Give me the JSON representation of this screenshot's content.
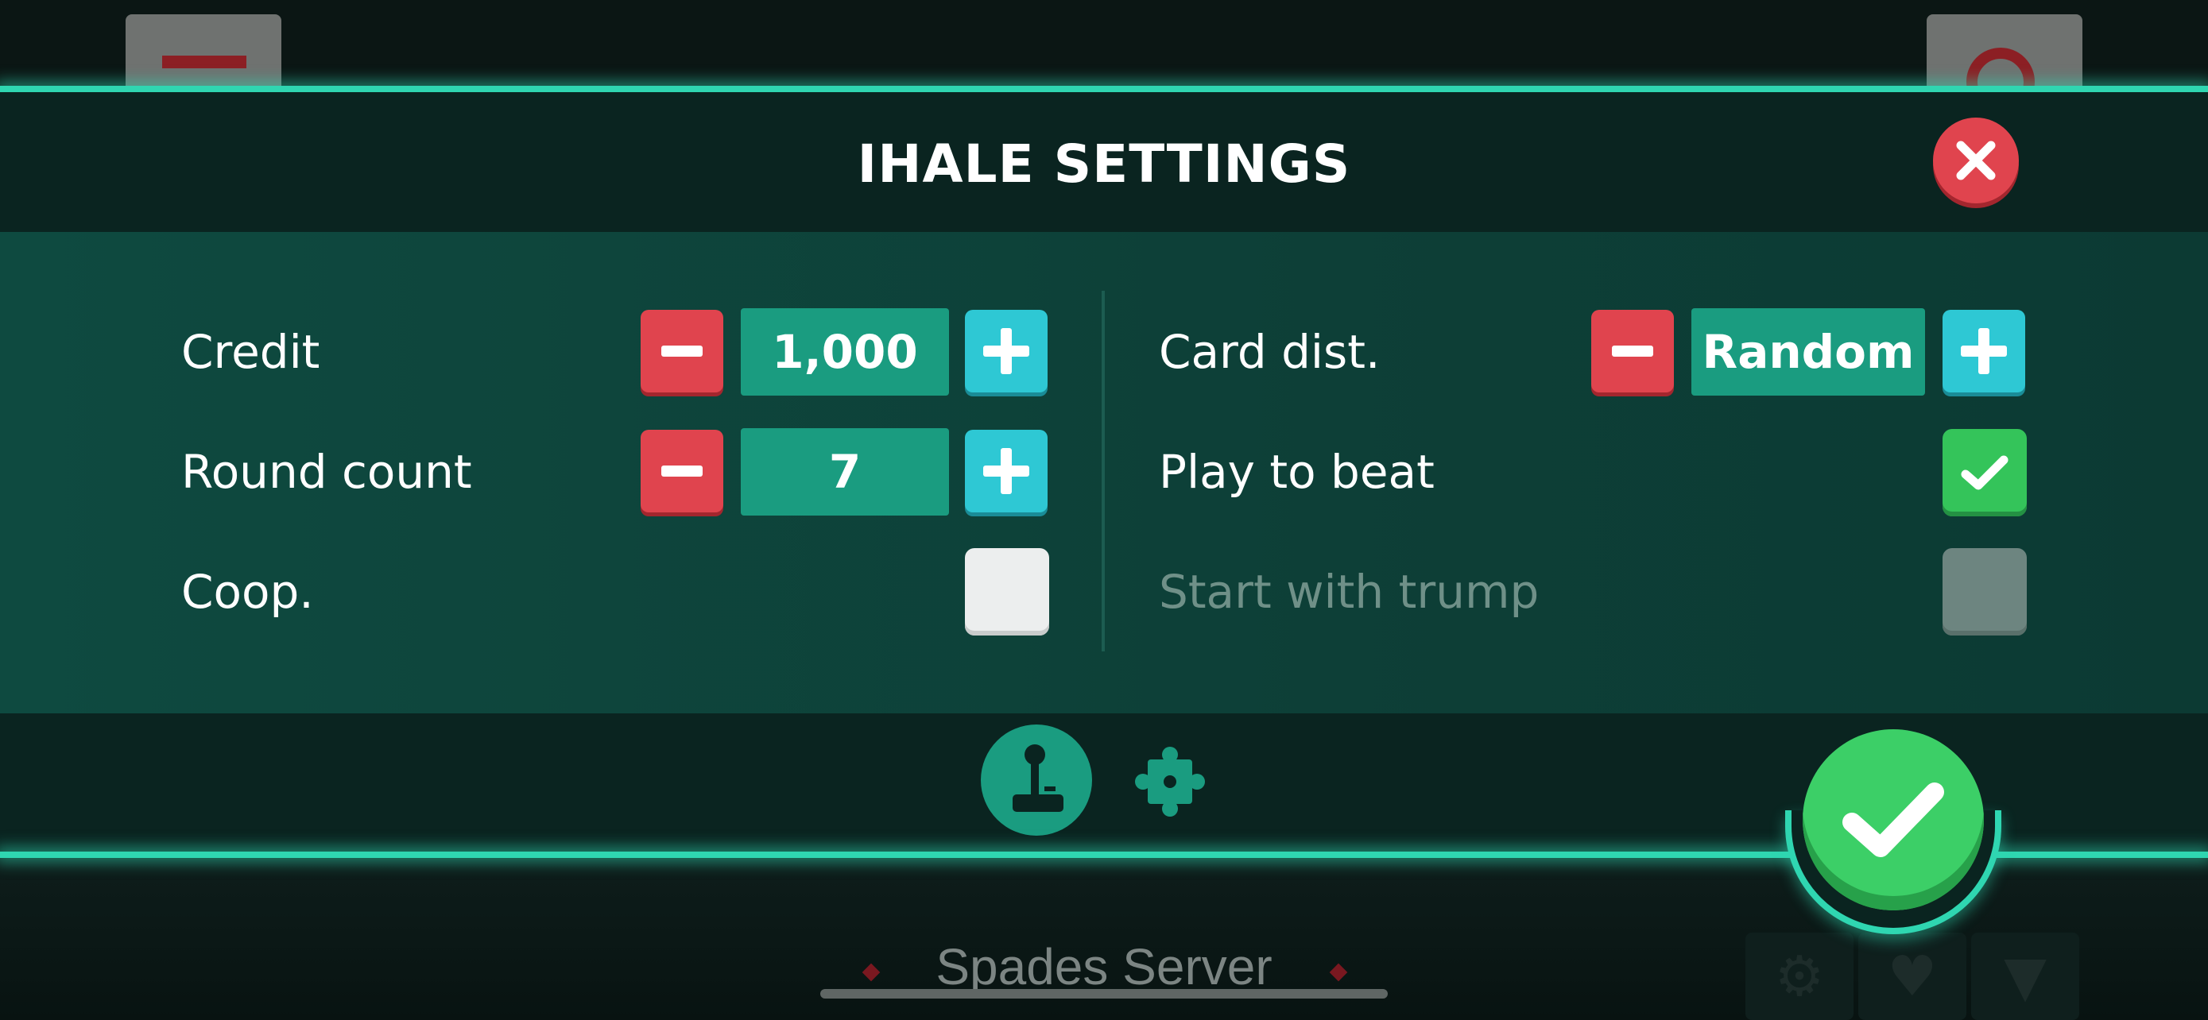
{
  "modal": {
    "title": "IHALE SETTINGS"
  },
  "settings_left": [
    {
      "label": "Credit",
      "value": "1,000",
      "control": "stepper"
    },
    {
      "label": "Round count",
      "value": "7",
      "control": "stepper"
    },
    {
      "label": "Coop.",
      "checked": false,
      "control": "checkbox"
    }
  ],
  "settings_right": [
    {
      "label": "Card dist.",
      "value": "Random",
      "control": "stepper"
    },
    {
      "label": "Play to beat",
      "checked": true,
      "control": "checkbox"
    },
    {
      "label": "Start with trump",
      "checked": false,
      "enabled": false,
      "control": "checkbox"
    }
  ],
  "footer": {
    "tabs": [
      {
        "icon": "joystick-icon",
        "active": true
      },
      {
        "icon": "puzzle-icon",
        "active": false
      }
    ],
    "confirm_icon": "checkmark-icon"
  },
  "background": {
    "server_label": "Spades Server",
    "bottom_icons": [
      "gear-icon",
      "heart-icon",
      "filter-icon"
    ]
  },
  "colors": {
    "accent_glow": "#2fd6b1",
    "minus_red": "#e0444e",
    "plus_cyan": "#2ec8d4",
    "value_teal": "#1a9c80",
    "check_green": "#34c45a"
  }
}
